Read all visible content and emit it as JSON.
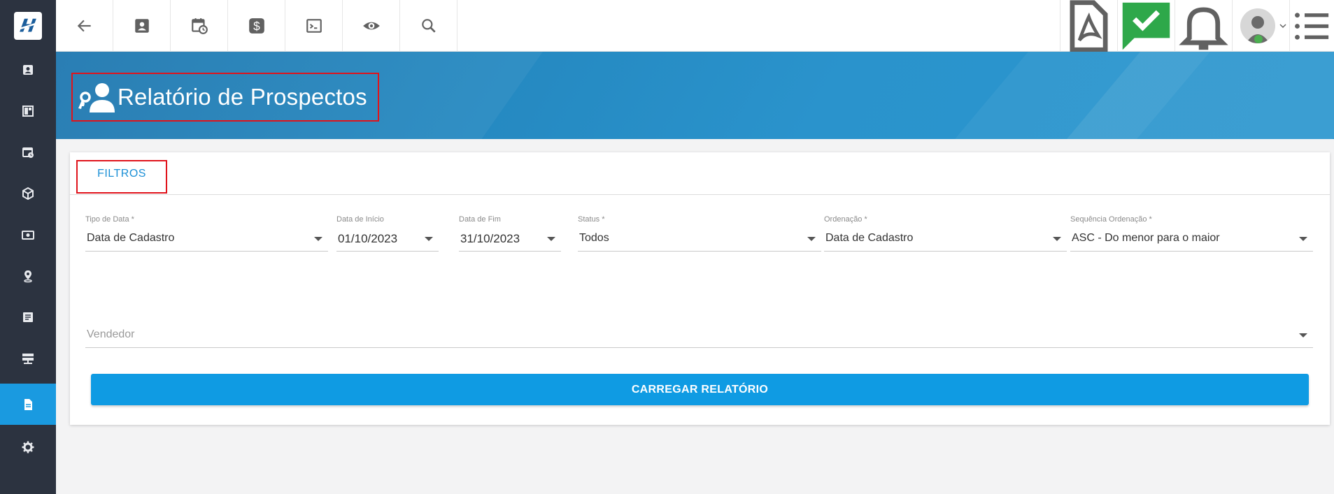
{
  "header": {
    "title": "Relatório de Prospectos"
  },
  "tabs": [
    {
      "label": "FILTROS"
    }
  ],
  "filters": {
    "tipo_data": {
      "label": "Tipo de Data *",
      "value": "Data de Cadastro"
    },
    "data_inicio": {
      "label": "Data de Início",
      "value": "01/10/2023"
    },
    "data_fim": {
      "label": "Data de Fim",
      "value": "31/10/2023"
    },
    "status": {
      "label": "Status *",
      "value": "Todos"
    },
    "ordenacao": {
      "label": "Ordenação *",
      "value": "Data de Cadastro"
    },
    "sequencia": {
      "label": "Sequência Ordenação *",
      "value": "ASC - Do menor para o maior"
    },
    "vendedor": {
      "placeholder": "Vendedor"
    }
  },
  "actions": {
    "load_label": "CARREGAR RELATÓRIO"
  },
  "colors": {
    "sidebar": "#2c3340",
    "accent": "#1a9ae0",
    "banner": "#2589c1",
    "highlight_border": "#e0131b",
    "button": "#0f9be3"
  },
  "icons": {
    "sidebar": [
      "contact-card-icon",
      "dashboard-icon",
      "calendar-clock-icon",
      "box-icon",
      "money-icon",
      "location-pin-icon",
      "document-list-icon",
      "server-icon",
      "report-icon",
      "gear-icon"
    ],
    "topbar": [
      "back-arrow-icon",
      "contact-card-icon",
      "calendar-clock-icon",
      "dollar-icon",
      "terminal-icon",
      "eye-icon",
      "search-icon",
      "pdf-icon",
      "chat-check-icon",
      "bell-icon",
      "avatar",
      "menu-list-icon"
    ]
  }
}
